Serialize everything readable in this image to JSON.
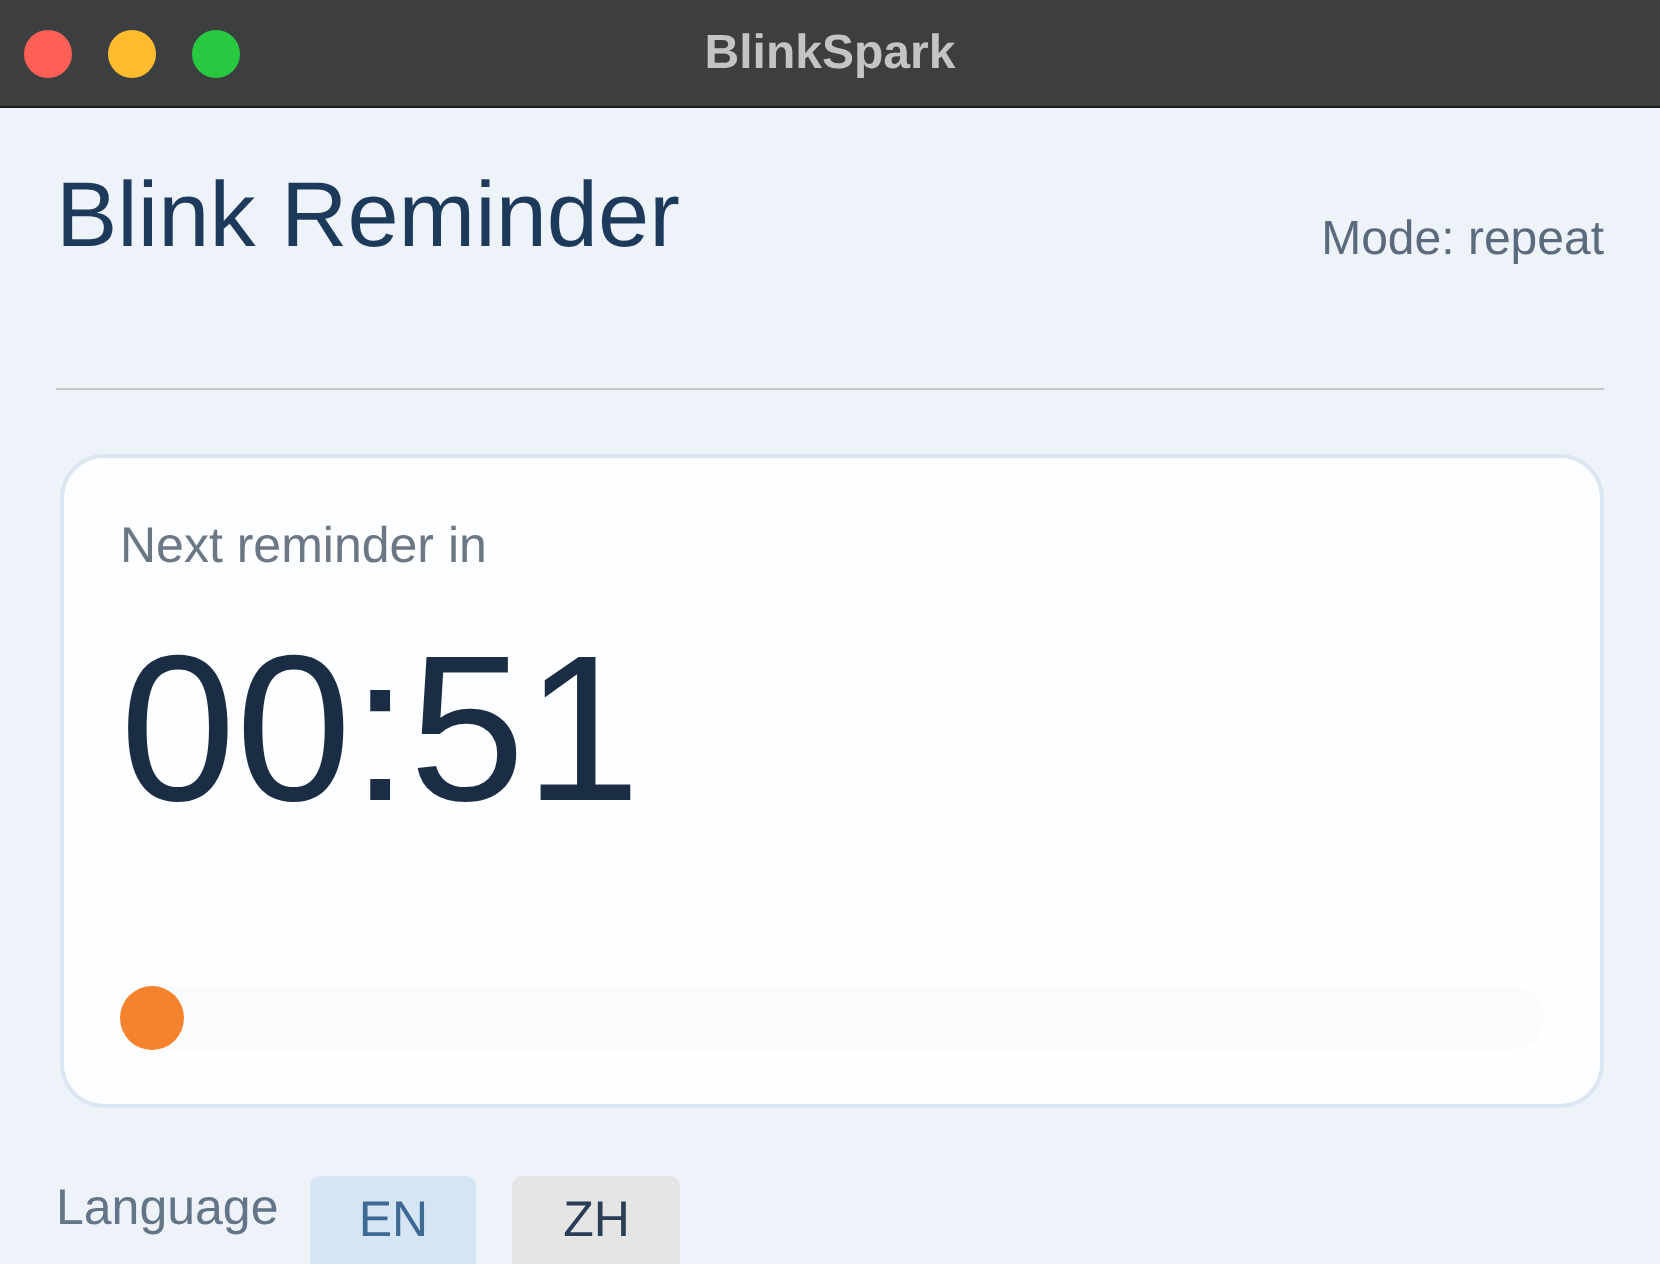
{
  "window": {
    "title": "BlinkSpark"
  },
  "header": {
    "title": "Blink Reminder",
    "mode": "Mode: repeat"
  },
  "timer_card": {
    "label": "Next reminder in",
    "countdown": "00:51",
    "progress": {
      "level": 0
    }
  },
  "language": {
    "label": "Language",
    "options": [
      {
        "label": "EN",
        "selected": true
      },
      {
        "label": "ZH",
        "selected": false
      }
    ]
  }
}
